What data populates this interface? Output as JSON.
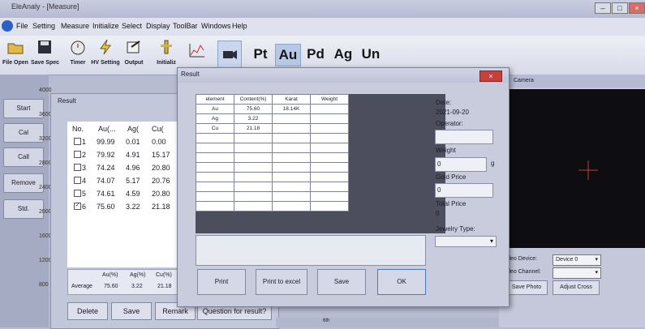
{
  "window": {
    "title": "EleAnaly - [Measure]",
    "min": "–",
    "max": "□",
    "close": "×"
  },
  "menu": [
    "File",
    "Setting",
    "Measure",
    "Initialize",
    "Select",
    "Display",
    "ToolBar",
    "Windows",
    "Help"
  ],
  "toolbar": {
    "buttons": [
      "File Open",
      "Save Spec",
      "Timer",
      "HV Setting",
      "Output",
      "Initializ"
    ],
    "elements": [
      "Pt",
      "Au",
      "Pd",
      "Ag",
      "Un"
    ],
    "selected_element": "Au"
  },
  "left_panel": {
    "buttons": [
      "Start",
      "Cal",
      "Call",
      "Remove",
      "Std."
    ],
    "axis_ticks": [
      "4000",
      "3600",
      "3200",
      "2800",
      "2400",
      "2000",
      "1600",
      "1200",
      "800"
    ]
  },
  "result_left": {
    "title": "Result",
    "headers": [
      "No.",
      "Au(...",
      "Ag(",
      "Cu("
    ],
    "rows": [
      {
        "no": "1",
        "au": "99.99",
        "ag": "0.01",
        "cu": "0.00",
        "checked": false
      },
      {
        "no": "2",
        "au": "79.92",
        "ag": "4.91",
        "cu": "15.17",
        "checked": false
      },
      {
        "no": "3",
        "au": "74.24",
        "ag": "4.96",
        "cu": "20.80",
        "checked": false
      },
      {
        "no": "4",
        "au": "74.07",
        "ag": "5.17",
        "cu": "20.76",
        "checked": false
      },
      {
        "no": "5",
        "au": "74.61",
        "ag": "4.59",
        "cu": "20.80",
        "checked": false
      },
      {
        "no": "6",
        "au": "75.60",
        "ag": "3.22",
        "cu": "21.18",
        "checked": true
      }
    ],
    "avg_headers": [
      "Au(%)",
      "Ag(%)",
      "Cu(%)"
    ],
    "avg_label": "Average",
    "avg_values": [
      "75.60",
      "3.22",
      "21.18"
    ],
    "buttons": [
      "Delete",
      "Save",
      "Remark",
      "Question for result?"
    ]
  },
  "dialog": {
    "title": "Result",
    "close": "×",
    "columns": [
      "element",
      "Content(%)",
      "Karat",
      "Weight"
    ],
    "rows": [
      [
        "Au",
        "75.60",
        "18.14K",
        ""
      ],
      [
        "Ag",
        "3.22",
        "",
        ""
      ],
      [
        "Cu",
        "21.18",
        "",
        ""
      ]
    ],
    "side": {
      "date_label": "Date:",
      "date_value": "2021-09-20",
      "operator_label": "Operator:",
      "operator_value": "",
      "weight_label": "Weight",
      "weight_value": "0",
      "weight_unit": "g",
      "gold_price_label": "Gold Price",
      "gold_price_value": "0",
      "total_price_label": "Total Price",
      "total_price_value": "0",
      "jewelry_type_label": "Jewelry Type:",
      "jewelry_type_value": ""
    },
    "buttons": {
      "print": "Print",
      "excel": "Print to excel",
      "save": "Save",
      "ok": "OK"
    }
  },
  "camera": {
    "title": "Camera",
    "device_label": "Video Device:",
    "device_value": "Device 0",
    "channel_label": "Video Channel:",
    "channel_value": "",
    "save_photo": "Save Photo",
    "adjust_cross": "Adjust Cross"
  },
  "bottom": {
    "label": "6th"
  }
}
